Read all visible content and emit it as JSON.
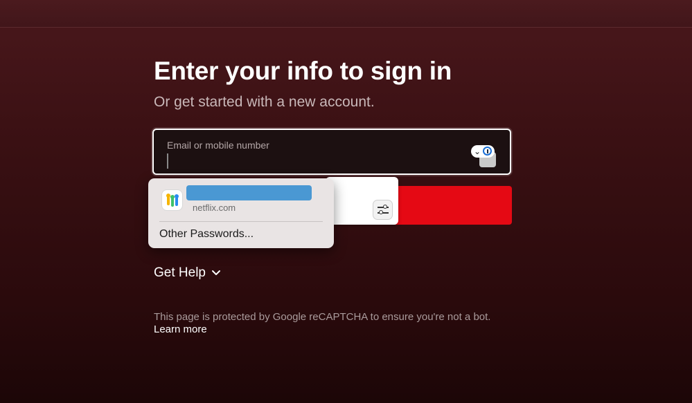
{
  "page": {
    "title": "Enter your info to sign in",
    "subtitle": "Or get started with a new account."
  },
  "email_field": {
    "label": "Email or mobile number",
    "value": ""
  },
  "password_popup": {
    "domain": "netflix.com",
    "other_passwords_label": "Other Passwords..."
  },
  "help": {
    "label": "Get Help"
  },
  "footer": {
    "recaptcha_text": "This page is protected by Google reCAPTCHA to ensure you're not a bot.",
    "learn_more": "Learn more"
  },
  "icons": {
    "password_manager": "password-manager-icon",
    "passwords_app": "passwords-app-icon",
    "settings": "sliders-icon",
    "help_chevron": "chevron-down-icon"
  },
  "colors": {
    "accent_red": "#e50914",
    "masked_user_blue": "#4a98d3",
    "background": "#3a1013"
  }
}
